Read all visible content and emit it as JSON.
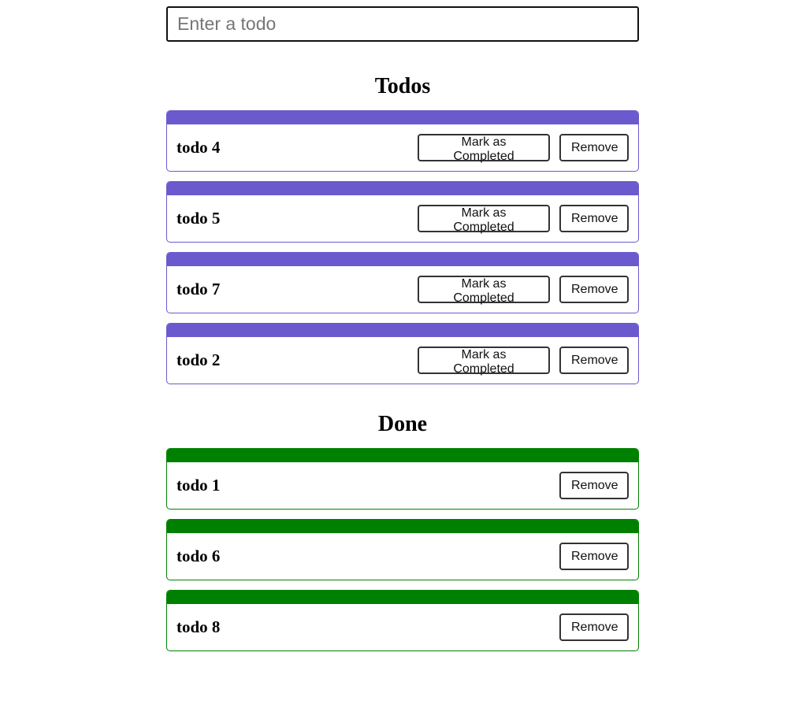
{
  "input": {
    "placeholder": "Enter a todo",
    "value": ""
  },
  "todos": {
    "title": "Todos",
    "accent": "#6a5acd",
    "items": [
      {
        "title": "todo 4",
        "complete_label": "Mark as Completed",
        "remove_label": "Remove"
      },
      {
        "title": "todo 5",
        "complete_label": "Mark as Completed",
        "remove_label": "Remove"
      },
      {
        "title": "todo 7",
        "complete_label": "Mark as Completed",
        "remove_label": "Remove"
      },
      {
        "title": "todo 2",
        "complete_label": "Mark as Completed",
        "remove_label": "Remove"
      }
    ]
  },
  "done": {
    "title": "Done",
    "accent": "#008000",
    "items": [
      {
        "title": "todo 1",
        "remove_label": "Remove"
      },
      {
        "title": "todo 6",
        "remove_label": "Remove"
      },
      {
        "title": "todo 8",
        "remove_label": "Remove"
      }
    ]
  }
}
